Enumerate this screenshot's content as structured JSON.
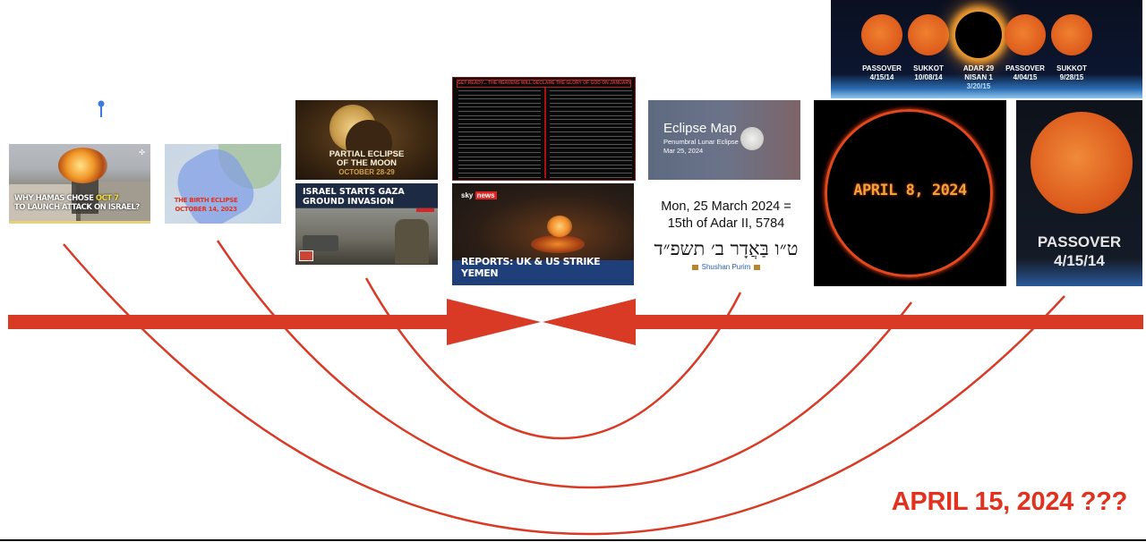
{
  "colors": {
    "accent_red": "#d93a26",
    "label_red": "#e0321f",
    "pin_blue": "#3b7be0"
  },
  "pin": {
    "icon": "map-pin-icon"
  },
  "thumbnails": {
    "hamas": {
      "line1_a": "WHY HAMAS CHOSE ",
      "line1_b": "OCT 7",
      "line2": "TO LAUNCH ATTACK ON ISRAEL?"
    },
    "birth_eclipse": {
      "line1": "THE BIRTH ECLIPSE",
      "line2": "OCTOBER 14, 2023"
    },
    "partial_eclipse": {
      "line1": "PARTIAL ECLIPSE",
      "line2": "OF THE MOON",
      "line3": "OCTOBER 28-29"
    },
    "gaza": {
      "line1": "ISRAEL STARTS GAZA",
      "line2": "GROUND INVASION"
    },
    "heavens_table": {
      "header": "GET READY... THE HEAVENS WILL DECLARE THE GLORY OF GOD ON JANUARY 11TH 2024"
    },
    "yemen": {
      "brand_a": "sky",
      "brand_b": "news",
      "headline": "REPORTS: UK & US STRIKE YEMEN"
    },
    "eclipse_map": {
      "title": "Eclipse Map",
      "subtitle": "Penumbral Lunar Eclipse",
      "date": "Mar 25, 2024"
    }
  },
  "date_block": {
    "line1": "Mon, 25 March 2024 =",
    "line2": "15th of Adar II, 5784",
    "hebrew": "ט״ו בַּאֲדָר ב׳ תשפ״ד",
    "holiday": "Shushan Purim"
  },
  "tetrad": {
    "labels": [
      {
        "l1": "PASSOVER",
        "l2": "4/15/14",
        "l3": ""
      },
      {
        "l1": "SUKKOT",
        "l2": "10/08/14",
        "l3": ""
      },
      {
        "l1": "ADAR 29",
        "l2": "NISAN 1",
        "l3": "3/20/15"
      },
      {
        "l1": "PASSOVER",
        "l2": "4/04/15",
        "l3": ""
      },
      {
        "l1": "SUKKOT",
        "l2": "9/28/15",
        "l3": ""
      }
    ]
  },
  "april8": {
    "text": "APRIL 8, 2024"
  },
  "passover": {
    "line1": "PASSOVER",
    "line2": "4/15/14"
  },
  "final_label": "APRIL 15, 2024 ???"
}
